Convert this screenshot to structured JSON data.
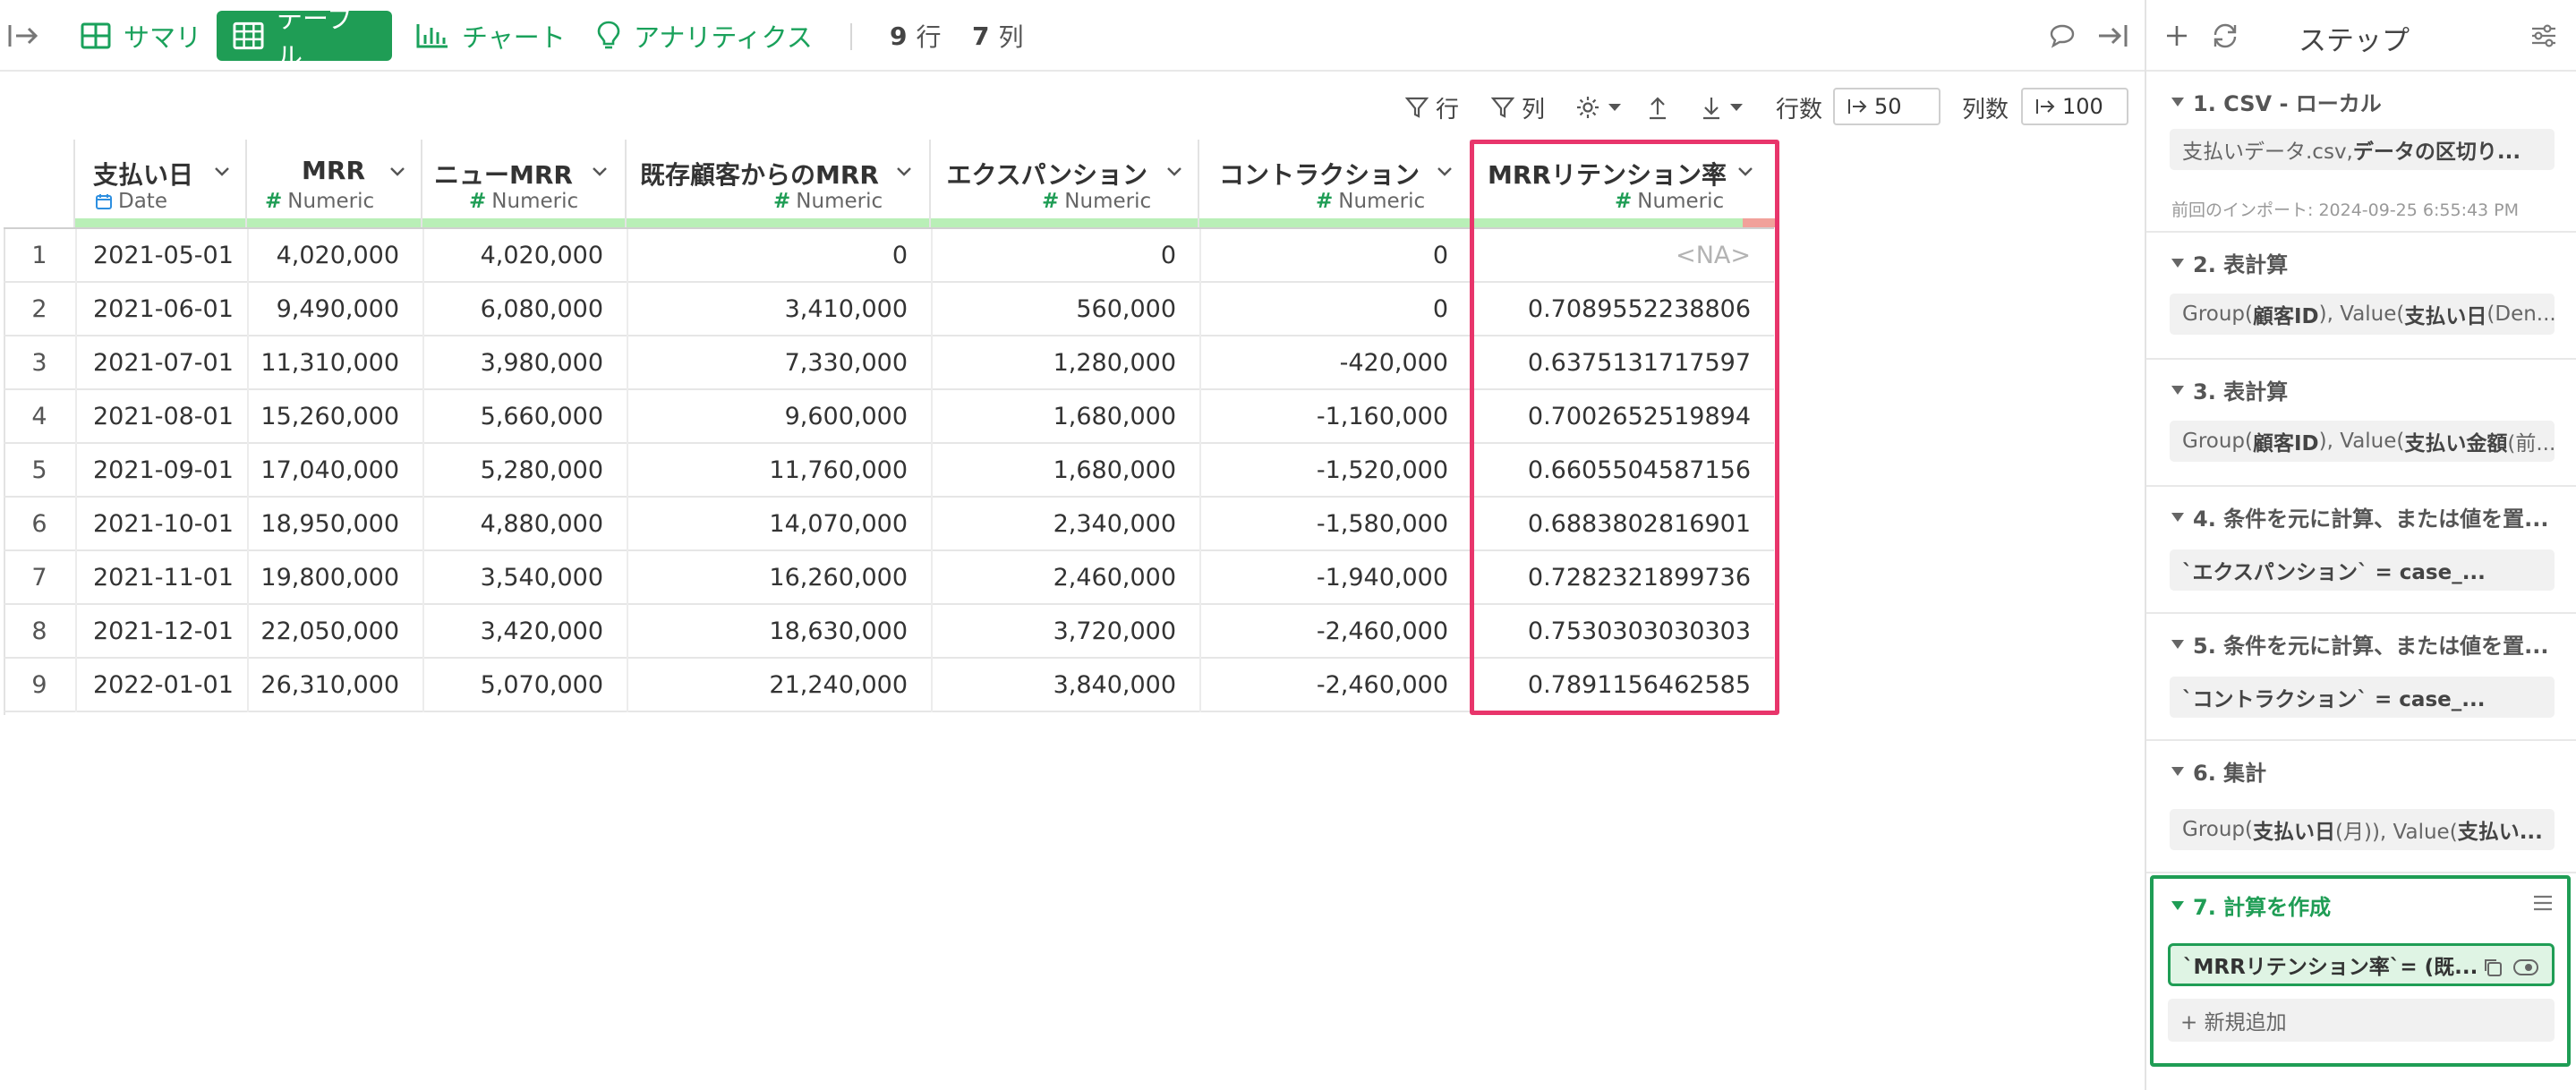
{
  "toolbar_top": {
    "tabs": [
      {
        "label": "サマリ",
        "icon": "summary-grid-icon"
      },
      {
        "label": "テーブル",
        "icon": "table-icon",
        "active": true
      },
      {
        "label": "チャート",
        "icon": "bar-chart-icon"
      },
      {
        "label": "アナリティクス",
        "icon": "lightbulb-icon"
      }
    ],
    "row_count": "9",
    "row_unit": "行",
    "col_count": "7",
    "col_unit": "列"
  },
  "toolbar": {
    "filter_rows_label": "行",
    "filter_cols_label": "列",
    "rows_label": "行数",
    "rows_value": "50",
    "cols_label": "列数",
    "cols_value": "100"
  },
  "table": {
    "columns": [
      {
        "name": "支払い日",
        "type": "Date"
      },
      {
        "name": "MRR",
        "type": "Numeric"
      },
      {
        "name": "ニューMRR",
        "type": "Numeric"
      },
      {
        "name": "既存顧客からのMRR",
        "type": "Numeric"
      },
      {
        "name": "エクスパンション",
        "type": "Numeric"
      },
      {
        "name": "コントラクション",
        "type": "Numeric"
      },
      {
        "name": "MRRリテンション率",
        "type": "Numeric"
      }
    ],
    "na_fraction_last_col": 0.11,
    "rows": [
      [
        "1",
        "2021-05-01",
        "4,020,000",
        "4,020,000",
        "0",
        "0",
        "0",
        "<NA>"
      ],
      [
        "2",
        "2021-06-01",
        "9,490,000",
        "6,080,000",
        "3,410,000",
        "560,000",
        "0",
        "0.7089552238806"
      ],
      [
        "3",
        "2021-07-01",
        "11,310,000",
        "3,980,000",
        "7,330,000",
        "1,280,000",
        "-420,000",
        "0.6375131717597"
      ],
      [
        "4",
        "2021-08-01",
        "15,260,000",
        "5,660,000",
        "9,600,000",
        "1,680,000",
        "-1,160,000",
        "0.7002652519894"
      ],
      [
        "5",
        "2021-09-01",
        "17,040,000",
        "5,280,000",
        "11,760,000",
        "1,680,000",
        "-1,520,000",
        "0.6605504587156"
      ],
      [
        "6",
        "2021-10-01",
        "18,950,000",
        "4,880,000",
        "14,070,000",
        "2,340,000",
        "-1,580,000",
        "0.6883802816901"
      ],
      [
        "7",
        "2021-11-01",
        "19,800,000",
        "3,540,000",
        "16,260,000",
        "2,460,000",
        "-1,940,000",
        "0.7282321899736"
      ],
      [
        "8",
        "2021-12-01",
        "22,050,000",
        "3,420,000",
        "18,630,000",
        "3,720,000",
        "-2,460,000",
        "0.7530303030303"
      ],
      [
        "9",
        "2022-01-01",
        "26,310,000",
        "5,070,000",
        "21,240,000",
        "3,840,000",
        "-2,460,000",
        "0.7891156462585"
      ]
    ]
  },
  "panel": {
    "title": "ステップ",
    "steps": [
      {
        "title": "1. CSV - ローカル",
        "body_a": "支払いデータ.csv, ",
        "body_b": "データの区切り...",
        "meta": "前回のインポート: 2024-09-25 6:55:43 PM"
      },
      {
        "title": "2. 表計算",
        "body_a": "Group(",
        "body_b": "顧客ID",
        "body_c": "), Value(",
        "body_d": "支払い日",
        "body_e": " (Den..."
      },
      {
        "title": "3. 表計算",
        "body_a": "Group(",
        "body_b": "顧客ID",
        "body_c": "), Value(",
        "body_d": "支払い金額",
        "body_e": " (前..."
      },
      {
        "title": "4. 条件を元に計算、または値を置...",
        "body": "`エクスパンション` = case_..."
      },
      {
        "title": "5. 条件を元に計算、または値を置...",
        "body": "`コントラクション` = case_..."
      },
      {
        "title": "6. 集計",
        "body_a": "Group(",
        "body_b": "支払い日",
        "body_c": " (月)), Value(",
        "body_d": "支払い..."
      },
      {
        "title": "7. 計算を作成",
        "body_a": "`MRRリテンション率`",
        "body_b": " = (既...",
        "add_new": "+ 新規追加"
      }
    ]
  },
  "colors": {
    "accent": "#1f9d55",
    "highlight": "#e8356b",
    "quality_ok": "#b9efb7",
    "quality_na": "#f1a19a"
  }
}
